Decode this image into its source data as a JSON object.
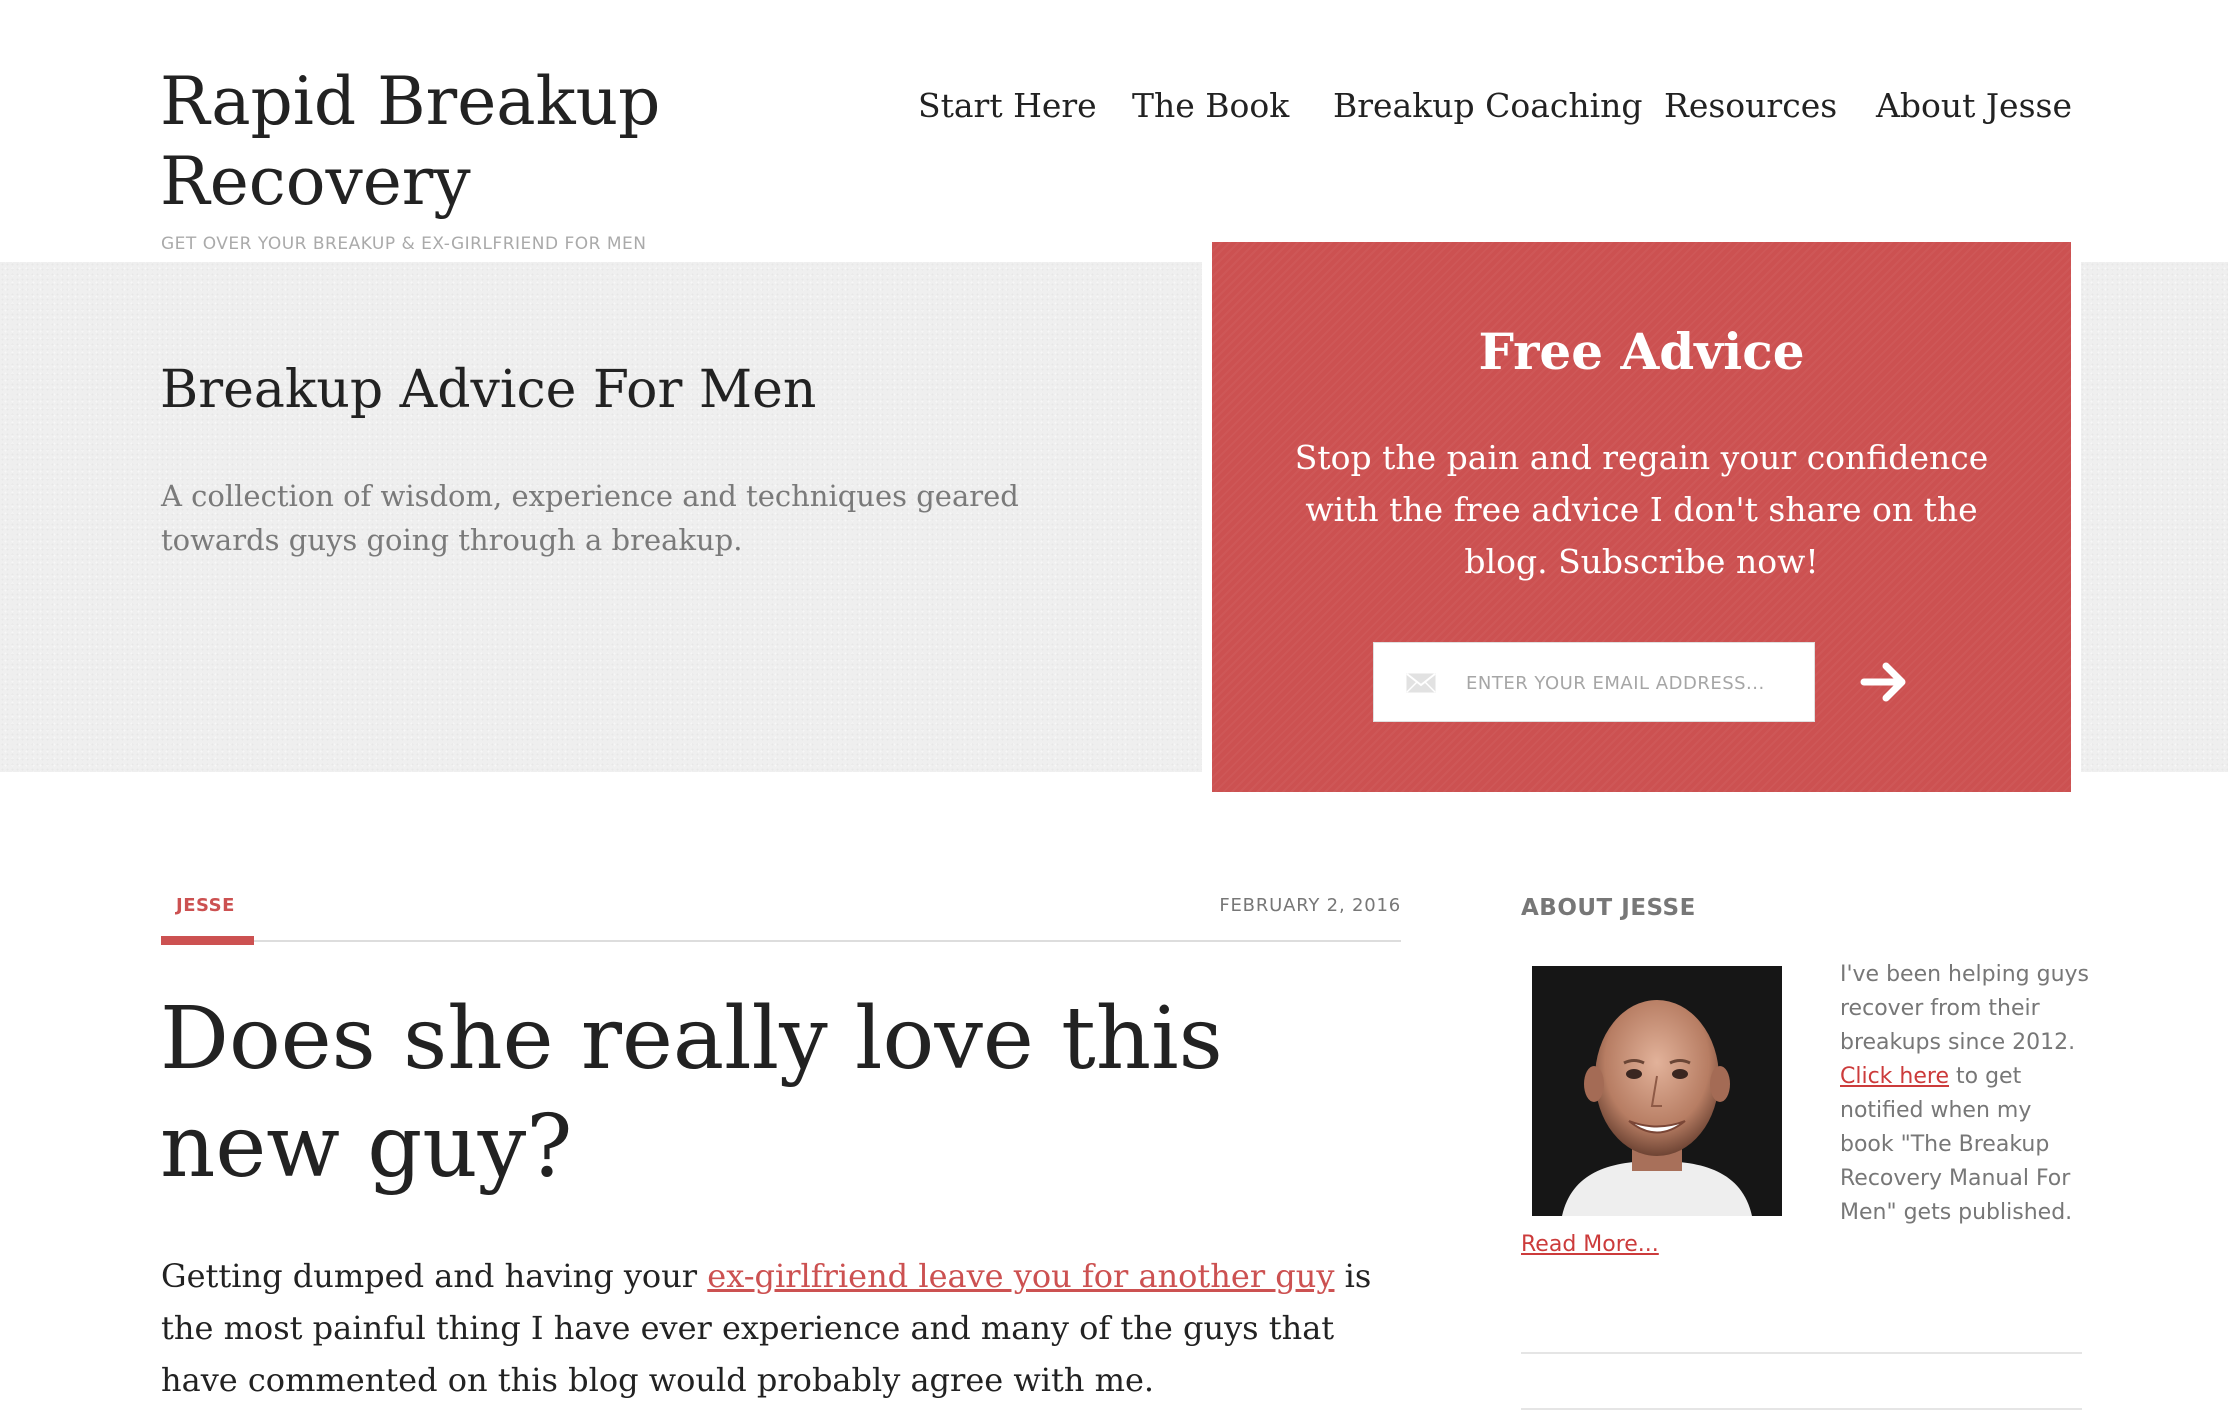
{
  "site": {
    "title": "Rapid Breakup Recovery",
    "tagline": "GET OVER YOUR BREAKUP & EX-GIRLFRIEND FOR MEN"
  },
  "nav": {
    "items": [
      {
        "label": "Start Here"
      },
      {
        "label": "The Book"
      },
      {
        "label": "Breakup Coaching"
      },
      {
        "label": "Resources"
      },
      {
        "label": "About Jesse"
      }
    ]
  },
  "hero": {
    "title": "Breakup Advice For Men",
    "description": "A collection of wisdom, experience and techniques geared towards guys going through a breakup."
  },
  "optin": {
    "heading": "Free Advice",
    "text": "Stop the pain and regain your confidence with the free advice I don't share on the blog. Subscribe now!",
    "email_placeholder": "ENTER YOUR EMAIL ADDRESS...",
    "submit_icon": "arrow-right-icon",
    "email_icon": "envelope-icon"
  },
  "post": {
    "author": "JESSE",
    "date": "FEBRUARY 2, 2016",
    "title": "Does she really love this new guy?",
    "body_before_link": "Getting dumped and having your ",
    "body_link": "ex-girlfriend leave you for another guy",
    "body_after_link": " is the most painful thing I have ever experience and many of the guys that have commented on this blog would probably agree with me."
  },
  "sidebar": {
    "heading": "ABOUT JESSE",
    "about_before_link": "I've been helping guys recover from their breakups since 2012. ",
    "about_link": "Click here",
    "about_after_link": " to get notified when my book \"The Breakup Recovery Manual For Men\" gets published.",
    "read_more": "Read More..."
  },
  "colors": {
    "accent": "#cc5151",
    "band": "#efefef",
    "muted": "#777777"
  }
}
